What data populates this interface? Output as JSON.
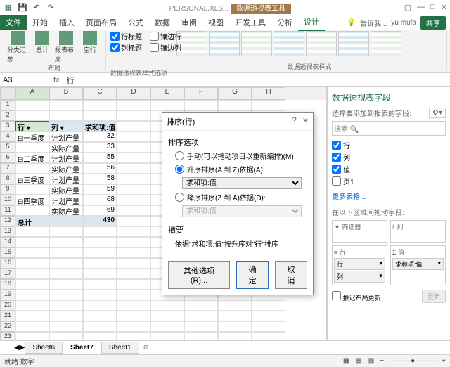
{
  "titlebar": {
    "doc": "PERSONAL.XLS...",
    "tools": "数据透视表工具",
    "user": "yu mufa",
    "share": "共享"
  },
  "tabs": {
    "file": "文件",
    "home": "开始",
    "insert": "插入",
    "layout": "页面布局",
    "formulas": "公式",
    "data": "数据",
    "review": "审阅",
    "view": "视图",
    "dev": "开发工具",
    "analyze": "分析",
    "design": "设计",
    "tellme": "告诉我..."
  },
  "ribbon": {
    "group1": "布局",
    "btn_subtotal": "分类汇总",
    "btn_grand": "总计",
    "btn_layout": "报表布局",
    "btn_blank": "空行",
    "group2": "数据透视表样式选项",
    "chk_rowhdr": "行标题",
    "chk_colhdr": "列标题",
    "chk_banded_row": "镶边行",
    "chk_banded_col": "镶边列",
    "group3": "数据透视表样式"
  },
  "namebox": "A3",
  "formula": "行",
  "headers": [
    "A",
    "B",
    "C",
    "D",
    "E",
    "F",
    "G",
    "H"
  ],
  "table": {
    "h_row": "行",
    "h_col": "列",
    "h_val": "求和项:值",
    "rows": [
      {
        "r": "一季度",
        "c": "计划产量",
        "v": 32
      },
      {
        "r": "",
        "c": "实际产量",
        "v": 33
      },
      {
        "r": "二季度",
        "c": "计划产量",
        "v": 55
      },
      {
        "r": "",
        "c": "实际产量",
        "v": 56
      },
      {
        "r": "三季度",
        "c": "计划产量",
        "v": 58
      },
      {
        "r": "",
        "c": "实际产量",
        "v": 59
      },
      {
        "r": "四季度",
        "c": "计划产量",
        "v": 68
      },
      {
        "r": "",
        "c": "实际产量",
        "v": 69
      }
    ],
    "total_label": "总计",
    "total_val": 430
  },
  "fieldpane": {
    "title": "数据透视表字段",
    "sub": "选择要添加到报表的字段:",
    "search": "搜索",
    "fields": [
      "行",
      "列",
      "值",
      "页1"
    ],
    "more": "更多表格...",
    "areas_hint": "在以下区域间拖动字段:",
    "filter": "筛选器",
    "columns": "列",
    "rowsl": "行",
    "values": "Σ 值",
    "row_item": "行",
    "col_item": "列",
    "val_item": "求和项:值",
    "defer": "推迟布局更新",
    "update": "更新"
  },
  "sheets": {
    "s1": "Sheet6",
    "s2": "Sheet7",
    "s3": "Sheet1"
  },
  "status": {
    "ready": "就绪",
    "mode": "数字"
  },
  "dialog": {
    "title": "排序(行)",
    "options": "排序选项",
    "r1": "手动(可以拖动项目以重新编排)(M)",
    "r2": "升序排序(A 到 Z)依据(A):",
    "r3": "降序排序(Z 到 A)依据(D):",
    "sel": "求和项:值",
    "summary": "摘要",
    "summary_text": "依据\"求和项:值\"按升序对\"行\"排序",
    "other": "其他选项(R)...",
    "ok": "确定",
    "cancel": "取消"
  }
}
